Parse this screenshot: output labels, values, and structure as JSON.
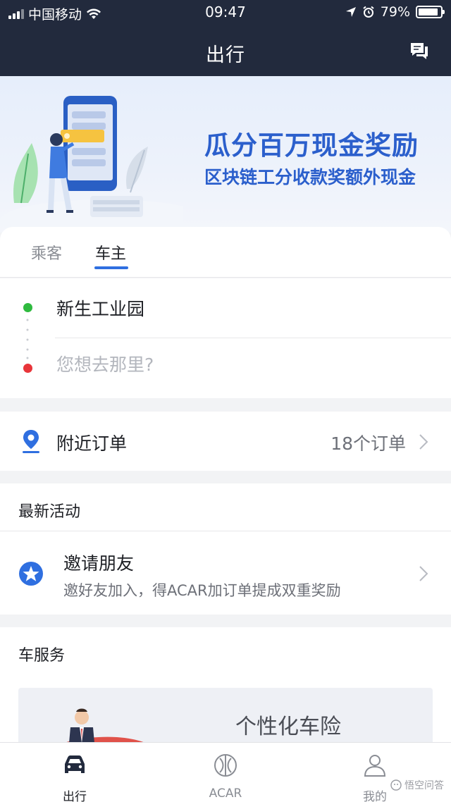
{
  "status_bar": {
    "carrier": "中国移动",
    "time": "09:47",
    "battery": "79%"
  },
  "nav": {
    "title": "出行",
    "message_icon": "chat-bubbles-icon"
  },
  "banner": {
    "title": "瓜分百万现金奖励",
    "subtitle": "区块链工分收款奖额外现金"
  },
  "tabs": [
    {
      "label": "乘客",
      "active": false
    },
    {
      "label": "车主",
      "active": true
    }
  ],
  "route": {
    "from": "新生工业园",
    "to_placeholder": "您想去那里?",
    "from_color": "#2fba3f",
    "to_color": "#e8353a"
  },
  "nearby": {
    "label": "附近订单",
    "count": "18个订单"
  },
  "activity": {
    "section_title": "最新活动",
    "item_title": "邀请朋友",
    "item_desc": "邀好友加入，得ACAR加订单提成双重奖励"
  },
  "service": {
    "section_title": "车服务",
    "card_title": "个性化车险"
  },
  "tabbar": [
    {
      "label": "出行",
      "icon": "car-icon",
      "active": true
    },
    {
      "label": "ACAR",
      "icon": "acar-logo-icon",
      "active": false
    },
    {
      "label": "我的",
      "icon": "user-icon",
      "active": false
    }
  ],
  "watermark": "悟空问答",
  "colors": {
    "nav_bg": "#222a3d",
    "accent": "#2f6fe0",
    "banner_text": "#2b5fcc"
  }
}
